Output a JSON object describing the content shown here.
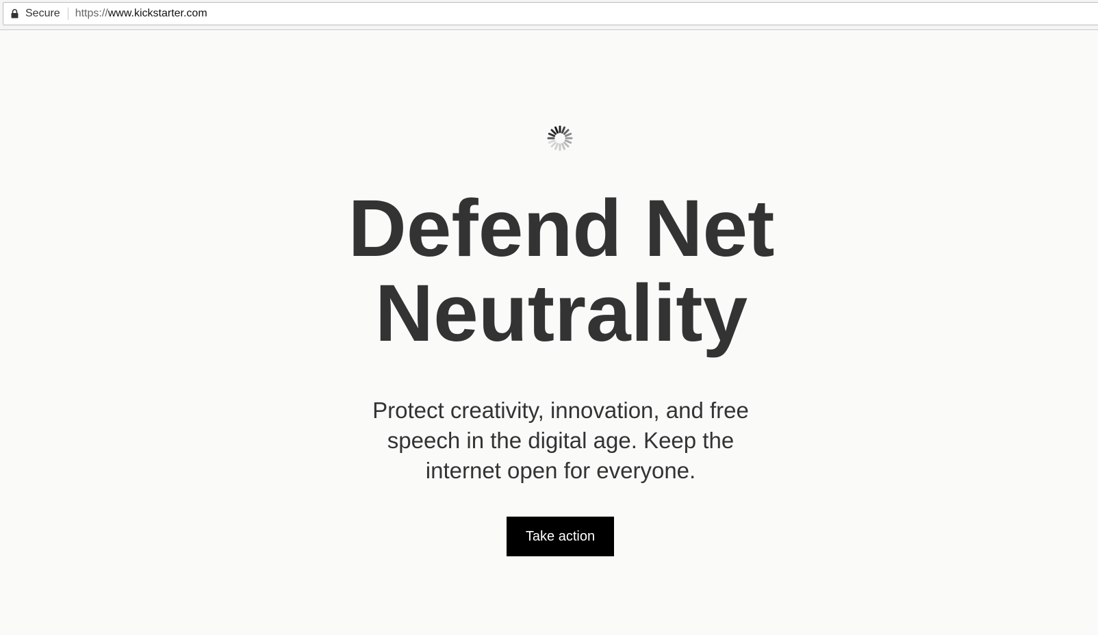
{
  "browser": {
    "secure_label": "Secure",
    "url_scheme": "https://",
    "url_host": "www.kickstarter.com"
  },
  "hero": {
    "headline_line1": "Defend Net",
    "headline_line2": "Neutrality",
    "subtitle": "Protect creativity, innovation, and free speech in the digital age. Keep the internet open for everyone.",
    "cta_label": "Take action"
  },
  "colors": {
    "background": "#fafaf9",
    "text": "#333333",
    "button_bg": "#000000",
    "button_text": "#ffffff"
  }
}
